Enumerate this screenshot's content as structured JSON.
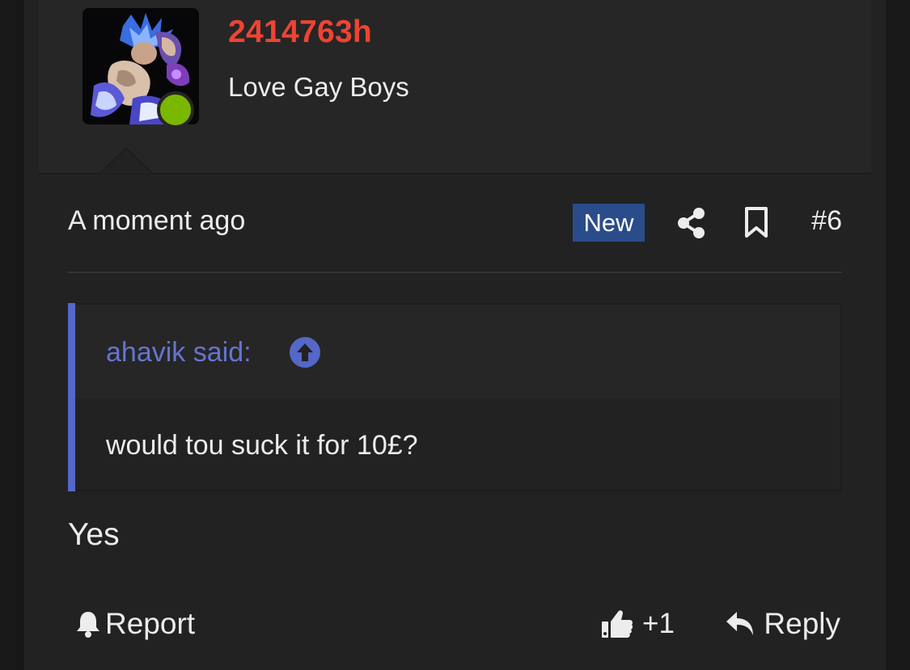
{
  "post": {
    "author": {
      "username": "2414763h",
      "title": "Love Gay Boys",
      "online": true,
      "avatar_icon": "anime-character-avatar"
    },
    "timestamp": "A moment ago",
    "badge": "New",
    "number": "#6",
    "quote": {
      "author_label": "ahavik said:",
      "text": "would tou suck it for 10£?"
    },
    "body": "Yes",
    "actions": {
      "report_label": "Report",
      "like_label": "+1",
      "reply_label": "Reply"
    }
  },
  "colors": {
    "username": "#ee4433",
    "quote_accent": "#5567c8",
    "new_badge": "#2b4c8a",
    "online": "#7ab800"
  }
}
